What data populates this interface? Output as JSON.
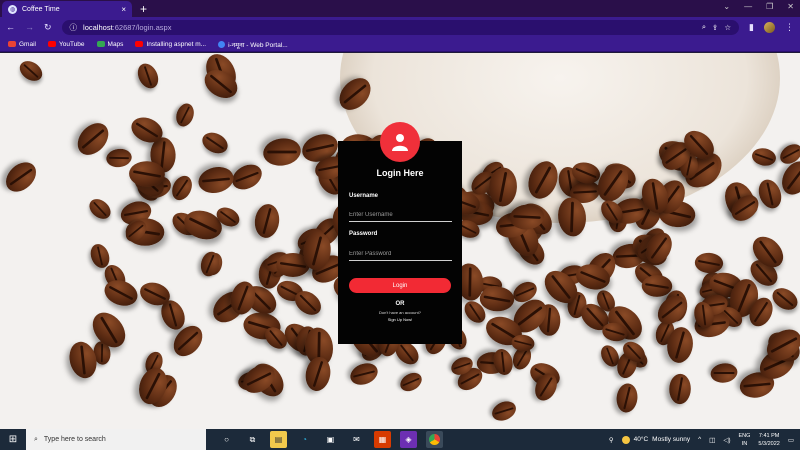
{
  "browser": {
    "tab_title": "Coffee Time",
    "new_tab": "+",
    "tab_close": "×",
    "url_host": "localhost",
    "url_path": ":62687/login.aspx",
    "bookmarks": [
      {
        "label": "Gmail",
        "color": "#ea4335"
      },
      {
        "label": "YouTube",
        "color": "#ff0000"
      },
      {
        "label": "Maps",
        "color": "#34a853"
      },
      {
        "label": "Installing aspnet m...",
        "color": "#ff0000"
      },
      {
        "label": "i-नमूना - Web Portal...",
        "color": "#4285f4"
      }
    ]
  },
  "login": {
    "title": "Login Here",
    "username_label": "Username",
    "username_placeholder": "Enter Username",
    "password_label": "Password",
    "password_placeholder": "Enter Password",
    "login_button": "Login",
    "or_text": "OR",
    "no_account_text": "Don't have an account?",
    "signup_link": "Sign Up Now!",
    "accent_color": "#f22a34"
  },
  "taskbar": {
    "search_placeholder": "Type here to search",
    "weather_temp": "40°C",
    "weather_desc": "Mostly sunny",
    "lang_line1": "ENG",
    "lang_line2": "IN",
    "time": "7:41 PM",
    "date": "5/3/2022"
  }
}
